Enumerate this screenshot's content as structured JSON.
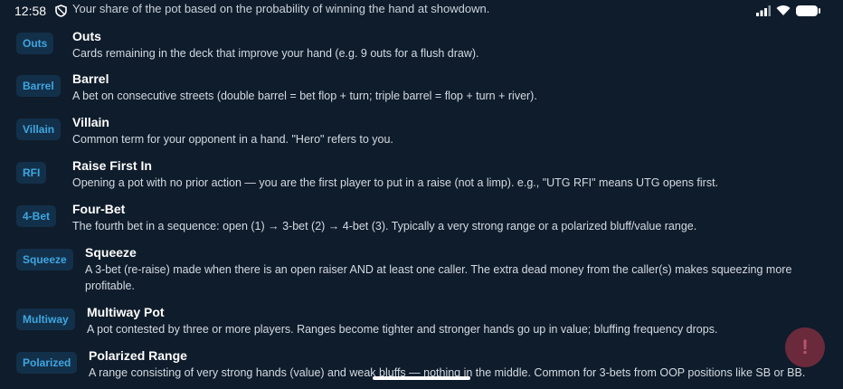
{
  "status": {
    "time": "12:58"
  },
  "top_partial_text": "Your share of the pot based on the probability of winning the hand at showdown.",
  "glossary": [
    {
      "badge": "Outs",
      "term": "Outs",
      "description": "Cards remaining in the deck that improve your hand (e.g. 9 outs for a flush draw)."
    },
    {
      "badge": "Barrel",
      "term": "Barrel",
      "description": "A bet on consecutive streets (double barrel = bet flop + turn; triple barrel = flop + turn + river)."
    },
    {
      "badge": "Villain",
      "term": "Villain",
      "description": "Common term for your opponent in a hand. \"Hero\" refers to you."
    },
    {
      "badge": "RFI",
      "term": "Raise First In",
      "description": "Opening a pot with no prior action — you are the first player to put in a raise (not a limp). e.g., \"UTG RFI\" means UTG opens first."
    },
    {
      "badge": "4-Bet",
      "term": "Four-Bet",
      "description": "The fourth bet in a sequence: open (1) → 3-bet (2) → 4-bet (3). Typically a very strong range or a polarized bluff/value range."
    },
    {
      "badge": "Squeeze",
      "term": "Squeeze",
      "description": "A 3-bet (re-raise) made when there is an open raiser AND at least one caller. The extra dead money from the caller(s) makes squeezing more profitable."
    },
    {
      "badge": "Multiway",
      "term": "Multiway Pot",
      "description": "A pot contested by three or more players. Ranges become tighter and stronger hands go up in value; bluffing frequency drops."
    },
    {
      "badge": "Polarized",
      "term": "Polarized Range",
      "description": "A range consisting of very strong hands (value) and weak bluffs — nothing in the middle. Common for 3-bets from OOP positions like SB or BB."
    }
  ],
  "fab": {
    "label": "!"
  }
}
